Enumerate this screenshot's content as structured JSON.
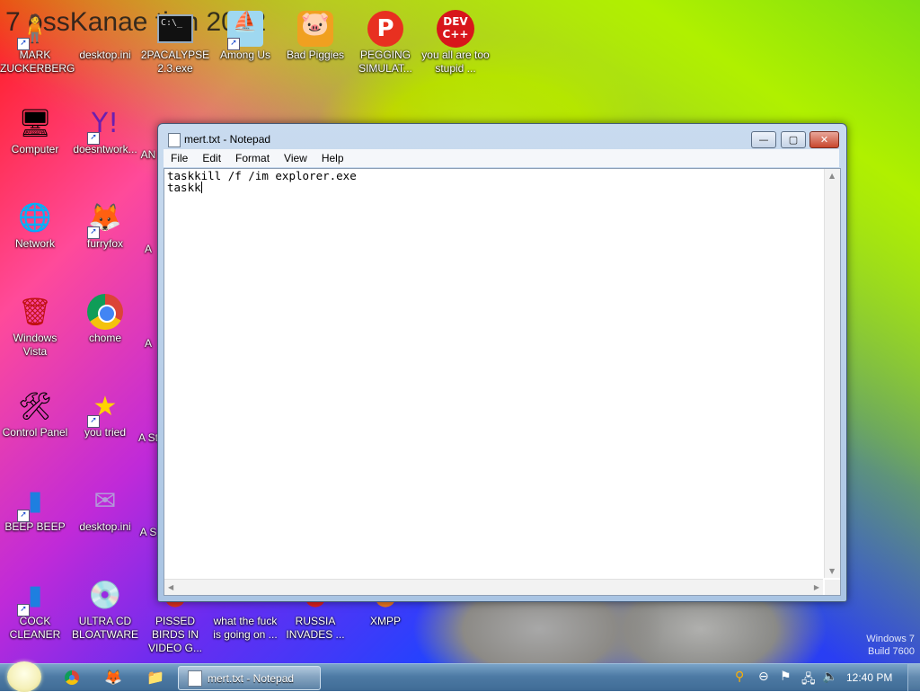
{
  "desktop": {
    "banner_text": "7 ossKanae tion 2012",
    "icons": [
      {
        "label": "MARK ZUCKERBERG",
        "icon": "person-icon"
      },
      {
        "label": "desktop.ini",
        "icon": "file-icon"
      },
      {
        "label": "2PACALYPSE 2.3.exe",
        "icon": "cmd-icon"
      },
      {
        "label": "Among Us",
        "icon": "game-icon"
      },
      {
        "label": "Bad Piggies",
        "icon": "pig-icon"
      },
      {
        "label": "PEGGING SIMULAT...",
        "icon": "p-icon"
      },
      {
        "label": "you all are too stupid ...",
        "icon": "devcpp-icon"
      },
      {
        "label": "Computer",
        "icon": "computer-icon"
      },
      {
        "label": "doesntwork...",
        "icon": "yahoo-icon"
      },
      {
        "label": "Network",
        "icon": "network-icon"
      },
      {
        "label": "furryfox",
        "icon": "firefox-icon"
      },
      {
        "label": "Windows Vista",
        "icon": "recycle-bin-icon"
      },
      {
        "label": "chome",
        "icon": "chrome-icon"
      },
      {
        "label": "Control Panel",
        "icon": "control-panel-icon"
      },
      {
        "label": "you tried",
        "icon": "star-icon"
      },
      {
        "label": "BEEP BEEP",
        "icon": "blue-file-icon"
      },
      {
        "label": "desktop.ini",
        "icon": "file-icon"
      },
      {
        "label": "COCK CLEANER",
        "icon": "blue-file-icon"
      },
      {
        "label": "ULTRA CD BLOATWARE",
        "icon": "cd-icon"
      },
      {
        "label": "PISSED BIRDS IN VIDEO G...",
        "icon": "bird-icon"
      },
      {
        "label": "what the fuck is going on ...",
        "icon": "pace-icon"
      },
      {
        "label": "RUSSIA INVADES ...",
        "icon": "red-icon"
      },
      {
        "label": "XMPP",
        "icon": "xmpp-icon"
      }
    ],
    "partial_labels": [
      "AN",
      "A",
      "A",
      "A",
      "A St",
      "A S"
    ],
    "watermark": [
      "Windows 7",
      "Build 7600"
    ]
  },
  "notepad": {
    "title": "mert.txt - Notepad",
    "menu": [
      "File",
      "Edit",
      "Format",
      "View",
      "Help"
    ],
    "lines": [
      "taskkill /f /im explorer.exe",
      "taskk"
    ],
    "minimize_symbol": "—",
    "maximize_symbol": "▢",
    "close_symbol": "✕"
  },
  "taskbar": {
    "pinned": [
      "chrome-icon",
      "firefox-icon",
      "explorer-icon"
    ],
    "task_label": "mert.txt - Notepad",
    "tray": [
      "search-icon",
      "minus-circle-icon",
      "flag-icon",
      "network-icon",
      "volume-icon"
    ],
    "time": "12:40 PM"
  }
}
